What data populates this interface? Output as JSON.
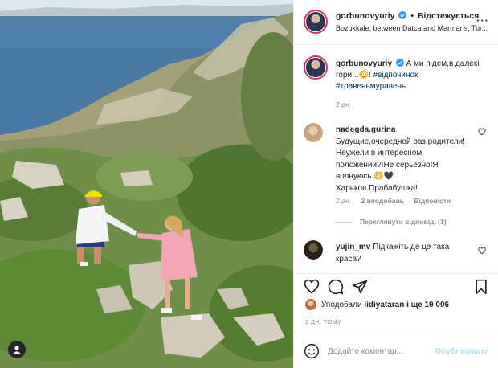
{
  "post": {
    "username": "gorbunovyuriy",
    "follow_label": "Відстежується",
    "location": "Bozukkale, between Datca and Marmaris, Tur..."
  },
  "caption": {
    "username": "gorbunovyuriy",
    "text": "А ми підем,в далекі гори...😳!",
    "tags": [
      "#відпочинок",
      "#травеньмуравень"
    ],
    "time": "2 дн."
  },
  "comments": [
    {
      "username": "nadegda.gurina",
      "text": "Будущие,очередной раз,родители!Неужели в интересном положении?!Не серьёзно!Я волнуюсь.😳🖤 Харьков.Прабабушка!",
      "time": "2 дн.",
      "likes": "2 вподобань",
      "reply": "Відповісти",
      "view_replies": "Переглянути відповіді (1)"
    },
    {
      "username": "yujin_mv",
      "text": "Підкажіть де це така краса?"
    }
  ],
  "likes": {
    "prefix": "Уподобали",
    "user": "lidiyataran",
    "suffix": "і ще 19 006"
  },
  "post_time": "2 ДН. ТОМУ",
  "composer": {
    "placeholder": "Додайте коментар...",
    "publish_label": "Опублікувати"
  },
  "colors": {
    "sea": "#4a79a6",
    "link": "#00376b",
    "verified": "#3897f0",
    "publish_disabled": "#b2dffc"
  },
  "icons": [
    "verified-icon",
    "more-icon",
    "heart-icon",
    "comment-icon",
    "share-icon",
    "bookmark-icon",
    "emoji-icon",
    "user-tag-icon"
  ]
}
